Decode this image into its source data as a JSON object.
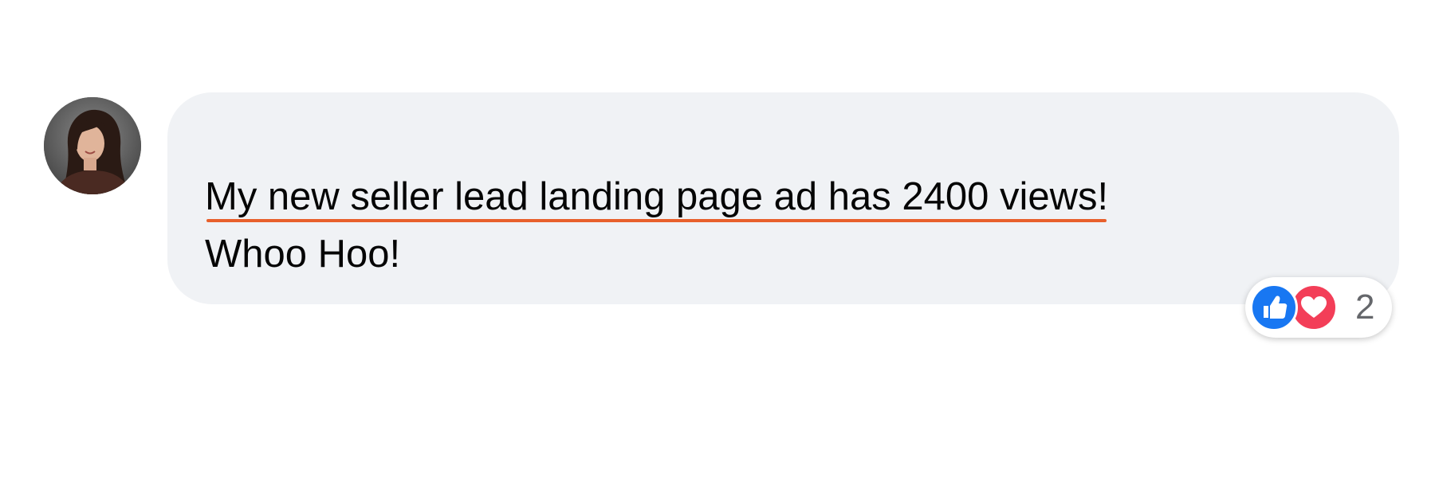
{
  "comment": {
    "lines": [
      "My new seller lead landing page ad has 2400 views!",
      "Whoo Hoo!"
    ],
    "highlight_color": "#e8602c",
    "bubble_color": "#f0f2f5",
    "text_color": "#050505"
  },
  "reactions": {
    "icons": [
      "like-icon",
      "love-icon"
    ],
    "count": "2",
    "like_color": "#1877f2",
    "love_color": "#f33e58"
  },
  "avatar": {
    "icon": "profile-photo"
  }
}
